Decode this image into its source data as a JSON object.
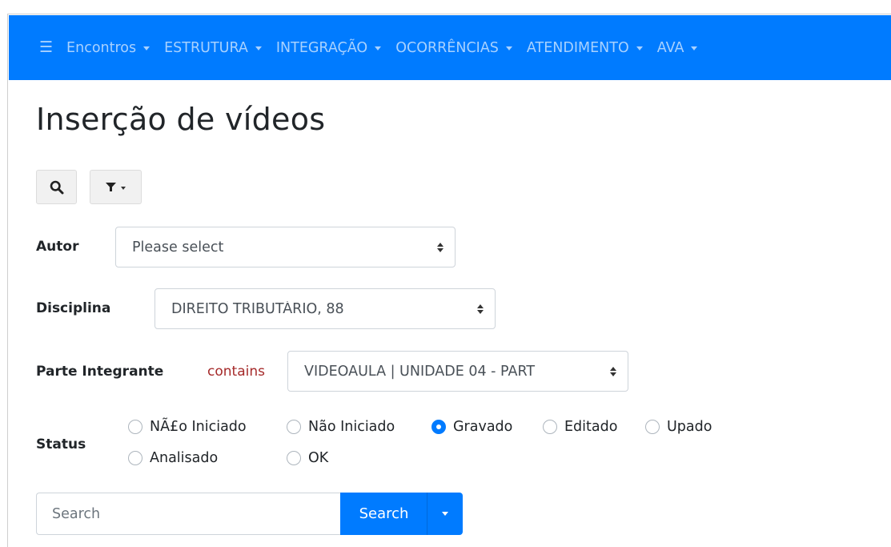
{
  "colors": {
    "primary": "#007bff",
    "nav_text": "#a8d1ff",
    "contains": "#a52a2a"
  },
  "navbar": {
    "toggle_icon": "hamburger-icon",
    "items": [
      {
        "label": "Encontros"
      },
      {
        "label": "ESTRUTURA"
      },
      {
        "label": "INTEGRAÇÃO"
      },
      {
        "label": "OCORRÊNCIAS"
      },
      {
        "label": "ATENDIMENTO"
      },
      {
        "label": "AVA"
      }
    ]
  },
  "page": {
    "title": "Inserção de vídeos"
  },
  "toolbar": {
    "search_icon": "search-icon",
    "filter_icon": "filter-icon"
  },
  "form": {
    "autor": {
      "label": "Autor",
      "value": "Please select"
    },
    "disciplina": {
      "label": "Disciplina",
      "value": "DIREITO TRIBUTÁRIO, 88"
    },
    "parte": {
      "label": "Parte Integrante",
      "operator": "contains",
      "value": "VIDEOAULA | UNIDADE 04 - PART"
    },
    "status": {
      "label": "Status",
      "options": [
        {
          "label": "NÃ£o Iniciado",
          "checked": false
        },
        {
          "label": "Não Iniciado",
          "checked": false
        },
        {
          "label": "Gravado",
          "checked": true
        },
        {
          "label": "Editado",
          "checked": false
        },
        {
          "label": "Upado",
          "checked": false
        },
        {
          "label": "Analisado",
          "checked": false
        },
        {
          "label": "OK",
          "checked": false
        }
      ]
    }
  },
  "search": {
    "placeholder": "Search",
    "button_label": "Search"
  }
}
